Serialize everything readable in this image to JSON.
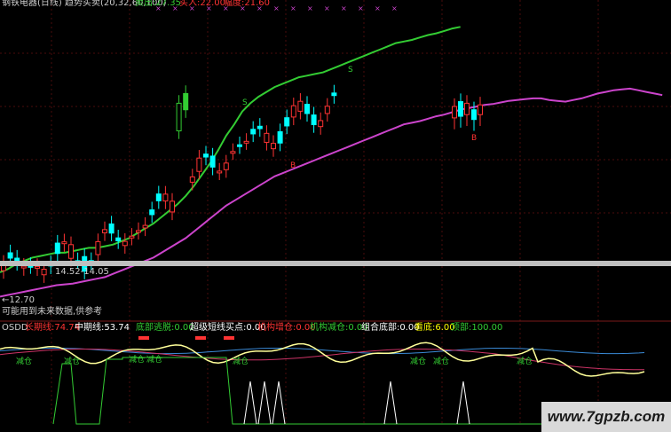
{
  "main_panel": {
    "title": "钢铁电器(日线)",
    "indicator": "趋势买卖(20,32,60,100)",
    "items": [
      {
        "label": "卖出:",
        "value": "27.35",
        "color": "#33cc33"
      },
      {
        "label": "买入:",
        "value": "22.00",
        "color": "#ff3333"
      },
      {
        "label": "幅度:",
        "value": "21.60",
        "color": "#ff3333"
      }
    ],
    "range_label": "14.52-14.05",
    "low_label": "12.70",
    "notice": "可能用到未来数据,供参考",
    "signals": {
      "sell": "S",
      "buy": "B"
    }
  },
  "sub_panel": {
    "name": "OSDD",
    "items": [
      {
        "label": "长期线",
        "value": "74.74",
        "color": "#ff3333"
      },
      {
        "label": "中期线",
        "value": "53.74",
        "color": "#ffffff"
      },
      {
        "label": "底部逃脱",
        "value": "0.00",
        "color": "#33cc33"
      },
      {
        "label": "超级短线买点",
        "value": "0.00",
        "color": "#ffffff"
      },
      {
        "label": "机构增仓",
        "value": "0.00",
        "color": "#ff3333"
      },
      {
        "label": "机构减仓",
        "value": "0.00",
        "color": "#33cc33"
      },
      {
        "label": "组合底部",
        "value": "0.00",
        "color": "#ffffff"
      },
      {
        "label": "看底",
        "value": "6.00",
        "color": "#ffff00"
      },
      {
        "label": "顶部",
        "value": "100.00",
        "color": "#33cc33"
      }
    ],
    "reduce_label": "减仓"
  },
  "watermark": "www.7gpzb.com",
  "colors": {
    "up": "#ff3333",
    "down": "#00ffff",
    "green": "#33cc33",
    "magenta": "#cc44cc",
    "yellow": "#ffff99",
    "grid": "#ff3333"
  },
  "chart_data": [
    {
      "type": "candlestick",
      "title": "钢铁电器(日线)",
      "ylim": [
        12.0,
        31.0
      ],
      "series": [
        {
          "name": "卖出",
          "color": "#33cc33",
          "values": [
            14.9,
            15.1,
            15.4,
            15.6,
            15.8,
            15.9,
            16.0,
            16.1,
            16.1,
            16.2,
            16.3,
            16.4,
            16.4,
            16.5,
            16.6,
            16.8,
            17.0,
            17.3,
            17.6,
            17.9,
            18.3,
            18.7,
            19.1,
            19.6,
            20.2,
            20.9,
            21.6,
            22.4,
            23.3,
            24.0,
            24.8,
            25.3,
            25.7,
            26.0,
            26.3,
            26.5,
            26.7,
            26.9,
            27.0,
            27.1,
            27.2,
            27.4,
            27.6,
            27.8,
            28.0,
            28.2,
            28.4,
            28.6,
            28.8,
            29.0,
            29.1,
            29.2,
            29.35,
            29.5,
            29.6,
            29.75,
            29.9,
            30.0
          ]
        },
        {
          "name": "买入",
          "color": "#cc44cc",
          "values": [
            13.4,
            13.5,
            13.6,
            13.7,
            13.8,
            13.9,
            14.0,
            14.1,
            14.15,
            14.2,
            14.3,
            14.4,
            14.5,
            14.6,
            14.8,
            15.0,
            15.2,
            15.4,
            15.6,
            15.8,
            16.1,
            16.4,
            16.7,
            17.0,
            17.4,
            17.8,
            18.2,
            18.6,
            19.0,
            19.3,
            19.6,
            19.9,
            20.2,
            20.5,
            20.8,
            21.0,
            21.2,
            21.4,
            21.6,
            21.8,
            22.0,
            22.2,
            22.4,
            22.6,
            22.8,
            23.0,
            23.2,
            23.4,
            23.6,
            23.8,
            24.0,
            24.1,
            24.2,
            24.35,
            24.5,
            24.6,
            24.75,
            24.9,
            25.0,
            25.1,
            25.2,
            25.25,
            25.35,
            25.45,
            25.5,
            25.55,
            25.6,
            25.6,
            25.5,
            25.45,
            25.4,
            25.5,
            25.6,
            25.75,
            25.9,
            26.0,
            26.1,
            26.15,
            26.2,
            26.1,
            26.0,
            25.9,
            25.8
          ]
        },
        {
          "name": "candles",
          "close_open_high_low": "omitted"
        }
      ],
      "annotations": [
        "14.52-14.05",
        "12.70",
        "S",
        "B"
      ]
    },
    {
      "type": "line",
      "title": "OSDD",
      "ylim": [
        0,
        100
      ],
      "series": [
        {
          "name": "长期线",
          "color": "#ff3333"
        },
        {
          "name": "中期线",
          "color": "#ffffff"
        }
      ]
    }
  ]
}
